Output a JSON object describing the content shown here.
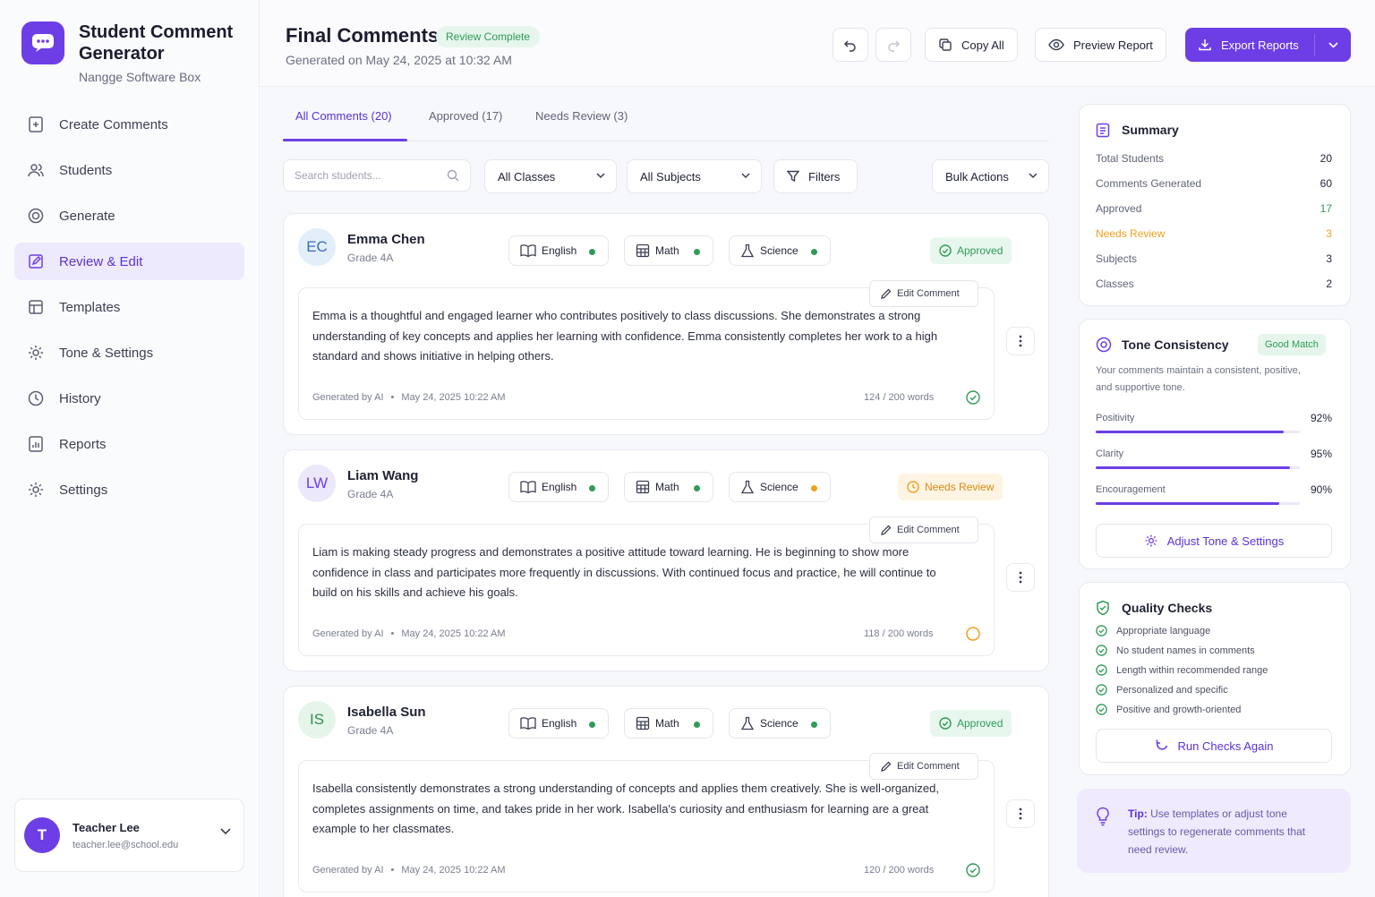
{
  "brand": {
    "title": "Student Comment Generator",
    "subtitle": "Nangge Software Box"
  },
  "nav": [
    {
      "label": "Create Comments",
      "icon": "file-plus-icon"
    },
    {
      "label": "Students",
      "icon": "users-icon"
    },
    {
      "label": "Generate",
      "icon": "target-icon"
    },
    {
      "label": "Review & Edit",
      "icon": "edit-icon",
      "active": true
    },
    {
      "label": "Templates",
      "icon": "template-icon"
    },
    {
      "label": "Tone & Settings",
      "icon": "gear-icon"
    },
    {
      "label": "History",
      "icon": "clock-icon"
    },
    {
      "label": "Reports",
      "icon": "report-icon"
    },
    {
      "label": "Settings",
      "icon": "gear-icon"
    }
  ],
  "user": {
    "initial": "T",
    "name": "Teacher Lee",
    "email": "teacher.lee@school.edu"
  },
  "header": {
    "title": "Final Comments",
    "badge": "Review Complete",
    "generated": "Generated on May 24, 2025 at 10:32 AM",
    "copy_all": "Copy All",
    "preview": "Preview Report",
    "export": "Export Reports"
  },
  "tabs": [
    "All Comments (20)",
    "Approved (17)",
    "Needs Review (3)"
  ],
  "filters": {
    "search_placeholder": "Search students...",
    "classes": "All Classes",
    "subjects": "All Subjects",
    "filters": "Filters",
    "bulk": "Bulk Actions"
  },
  "colors": {
    "accent": "#6d3ee6",
    "approved": "#2f9b57",
    "needs_review": "#f0a020"
  },
  "subjects": [
    "English",
    "Math",
    "Science"
  ],
  "edit_label": "Edit Comment",
  "students": [
    {
      "initials": "EC",
      "name": "Emma Chen",
      "grade": "Grade 4A",
      "status": "Approved",
      "status_type": "ok",
      "avatar_bg": "#e3eefb",
      "avatar_fg": "#3a6fb3",
      "dots": [
        "#2f9b57",
        "#2f9b57",
        "#2f9b57"
      ],
      "comment": "Emma is a thoughtful and engaged learner who contributes positively to class discussions. She demonstrates a strong understanding of key concepts and applies her learning with confidence. Emma consistently completes her work to a high standard and shows initiative in helping others.",
      "generated_by": "Generated by AI",
      "timestamp": "May 24, 2025 10:22 AM",
      "words": "124 / 200 words"
    },
    {
      "initials": "LW",
      "name": "Liam Wang",
      "grade": "Grade 4A",
      "status": "Needs Review",
      "status_type": "warn",
      "avatar_bg": "#ece8fb",
      "avatar_fg": "#6d3ee6",
      "dots": [
        "#2f9b57",
        "#2f9b57",
        "#f0a020"
      ],
      "comment": "Liam is making steady progress and demonstrates a positive attitude toward learning. He is beginning to show more confidence in class and participates more frequently in discussions. With continued focus and practice, he will continue to build on his skills and achieve his goals.",
      "generated_by": "Generated by AI",
      "timestamp": "May 24, 2025 10:22 AM",
      "words": "118 / 200 words"
    },
    {
      "initials": "IS",
      "name": "Isabella Sun",
      "grade": "Grade 4A",
      "status": "Approved",
      "status_type": "ok",
      "avatar_bg": "#e6f5ea",
      "avatar_fg": "#2f8f52",
      "dots": [
        "#2f9b57",
        "#2f9b57",
        "#2f9b57"
      ],
      "comment": "Isabella consistently demonstrates a strong understanding of concepts and applies them creatively. She is well-organized, completes assignments on time, and takes pride in her work. Isabella's curiosity and enthusiasm for learning are a great example to her classmates.",
      "generated_by": "Generated by AI",
      "timestamp": "May 24, 2025 10:22 AM",
      "words": "120 / 200 words"
    }
  ],
  "summary": {
    "title": "Summary",
    "rows": [
      {
        "label": "Total Students",
        "value": "20"
      },
      {
        "label": "Comments Generated",
        "value": "60"
      },
      {
        "label": "Approved",
        "value": "17",
        "color": "#2f9b57"
      },
      {
        "label": "Needs Review",
        "value": "3",
        "color": "#f0a020"
      },
      {
        "label": "Subjects",
        "value": "3"
      },
      {
        "label": "Classes",
        "value": "2"
      }
    ]
  },
  "tone": {
    "title": "Tone Consistency",
    "badge": "Good Match",
    "desc": "Your comments maintain a consistent, positive, and supportive tone.",
    "metrics": [
      {
        "label": "Positivity",
        "value": "92%",
        "pct": 92
      },
      {
        "label": "Clarity",
        "value": "95%",
        "pct": 95
      },
      {
        "label": "Encouragement",
        "value": "90%",
        "pct": 90
      }
    ],
    "button": "Adjust Tone & Settings"
  },
  "quality": {
    "title": "Quality Checks",
    "items": [
      "Appropriate language",
      "No student names in comments",
      "Length within recommended range",
      "Personalized and specific",
      "Positive and growth-oriented"
    ],
    "button": "Run Checks Again"
  },
  "tip": {
    "label": "Tip:",
    "text": "Use templates or adjust tone settings to regenerate comments that need review."
  }
}
